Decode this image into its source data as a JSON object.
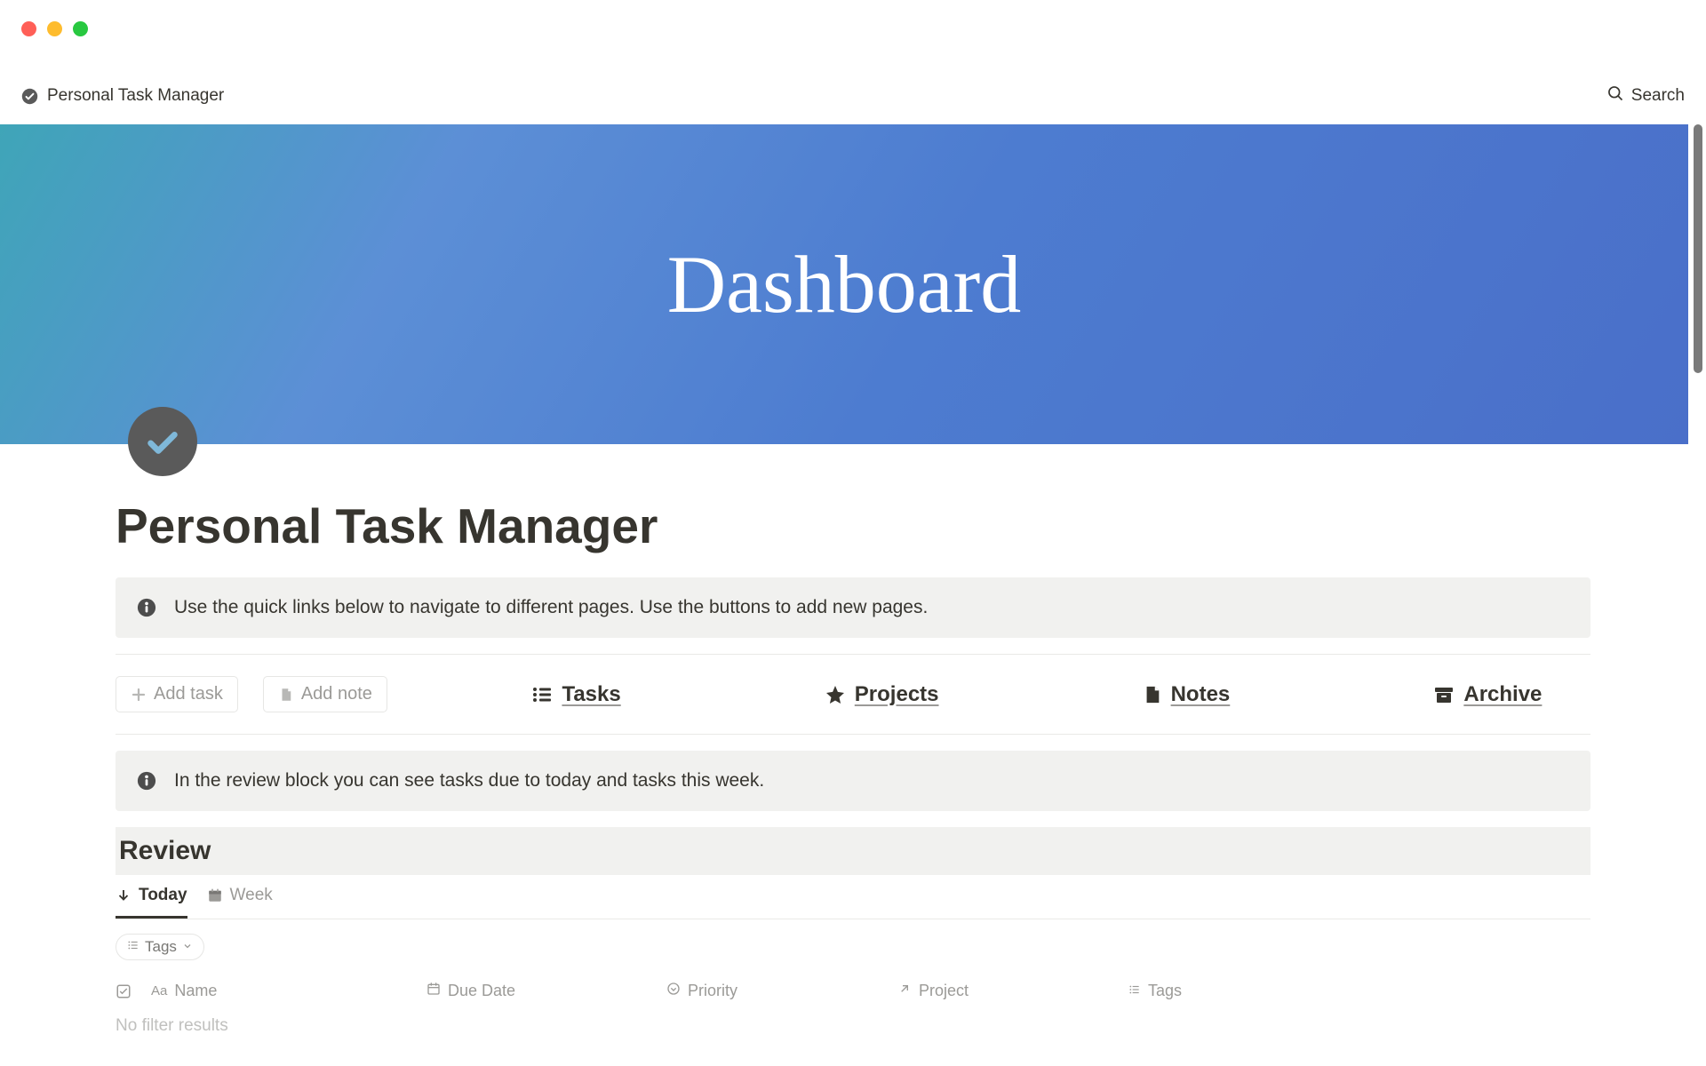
{
  "breadcrumb": {
    "title": "Personal Task Manager"
  },
  "search": {
    "label": "Search"
  },
  "cover": {
    "title": "Dashboard"
  },
  "page": {
    "title": "Personal Task Manager"
  },
  "callout1": {
    "text": "Use the quick links below to navigate to different pages. Use the buttons to add new pages."
  },
  "buttons": {
    "add_task": "Add task",
    "add_note": "Add note"
  },
  "quicklinks": {
    "tasks": "Tasks",
    "projects": "Projects",
    "notes": "Notes",
    "archive": "Archive"
  },
  "callout2": {
    "text": "In the review block you can see tasks due to today and tasks this week."
  },
  "review": {
    "heading": "Review",
    "tabs": {
      "today": "Today",
      "week": "Week"
    },
    "filter_chip": "Tags",
    "columns": {
      "name": "Name",
      "due": "Due Date",
      "priority": "Priority",
      "project": "Project",
      "tags": "Tags"
    },
    "empty": "No filter results"
  }
}
